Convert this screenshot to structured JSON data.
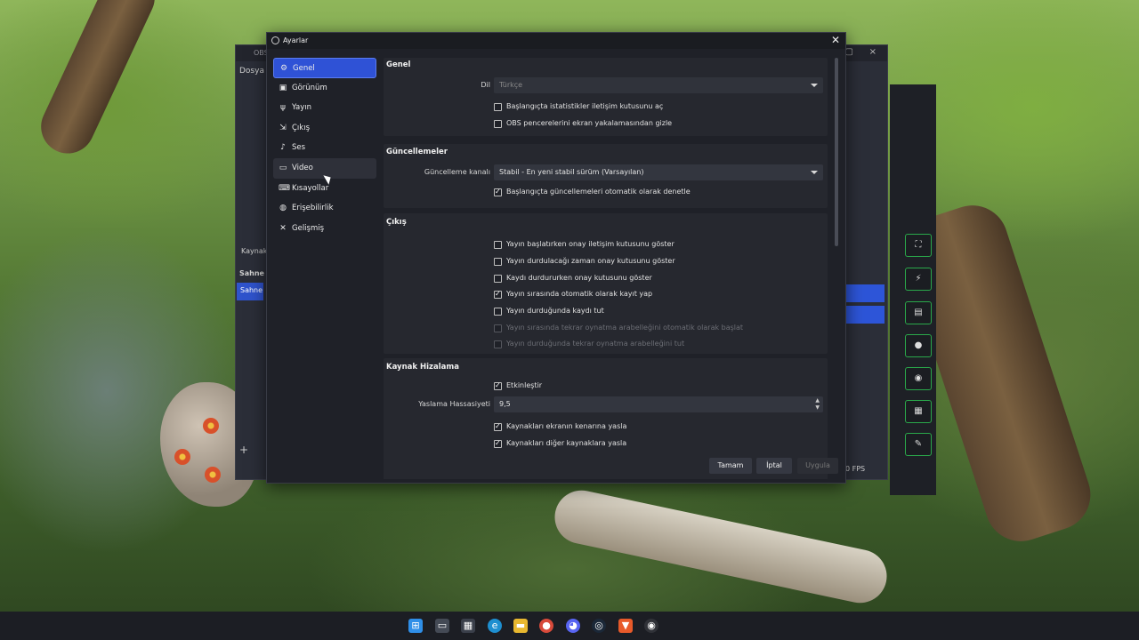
{
  "background_app": {
    "title": "OBS",
    "menu_item": "Dosya",
    "labels": {
      "kaynak": "Kaynak",
      "sahne_header": "Sahne",
      "sahne_item": "Sahne"
    },
    "fps_text": "0 FPS"
  },
  "dialog": {
    "title": "Ayarlar",
    "close_icon": "close-icon"
  },
  "sidebar": {
    "items": [
      {
        "label": "Genel",
        "icon": "gear-icon"
      },
      {
        "label": "Görünüm",
        "icon": "palette-icon"
      },
      {
        "label": "Yayın",
        "icon": "antenna-icon"
      },
      {
        "label": "Çıkış",
        "icon": "output-icon"
      },
      {
        "label": "Ses",
        "icon": "speaker-icon"
      },
      {
        "label": "Video",
        "icon": "monitor-icon"
      },
      {
        "label": "Kısayollar",
        "icon": "keyboard-icon"
      },
      {
        "label": "Erişebilirlik",
        "icon": "accessibility-icon"
      },
      {
        "label": "Gelişmiş",
        "icon": "wrench-icon"
      }
    ],
    "active_index": 0,
    "hover_index": 5
  },
  "sections": {
    "genel": {
      "title": "Genel",
      "language_label": "Dil",
      "language_value": "Türkçe",
      "checks": [
        {
          "label": "Başlangıçta istatistikler iletişim kutusunu aç",
          "checked": false
        },
        {
          "label": "OBS pencerelerini ekran yakalamasından gizle",
          "checked": false
        }
      ]
    },
    "guncellemeler": {
      "title": "Güncellemeler",
      "channel_label": "Güncelleme kanalı",
      "channel_value": "Stabil - En yeni stabil sürüm (Varsayılan)",
      "checks": [
        {
          "label": "Başlangıçta güncellemeleri otomatik olarak denetle",
          "checked": true
        }
      ]
    },
    "cikis": {
      "title": "Çıkış",
      "checks": [
        {
          "label": "Yayın başlatırken onay iletişim kutusunu göster",
          "checked": false,
          "disabled": false
        },
        {
          "label": "Yayın durdulacağı zaman onay kutusunu göster",
          "checked": false,
          "disabled": false
        },
        {
          "label": "Kaydı durdururken onay kutusunu göster",
          "checked": false,
          "disabled": false
        },
        {
          "label": "Yayın sırasında otomatik olarak kayıt yap",
          "checked": true,
          "disabled": false
        },
        {
          "label": "Yayın durduğunda kaydı tut",
          "checked": false,
          "disabled": false
        },
        {
          "label": "Yayın sırasında tekrar oynatma arabelleğini otomatik olarak başlat",
          "checked": false,
          "disabled": true
        },
        {
          "label": "Yayın durduğunda tekrar oynatma arabelleğini tut",
          "checked": false,
          "disabled": true
        }
      ]
    },
    "kaynak_hizalama": {
      "title": "Kaynak Hizalama",
      "enable_label": "Etkinleştir",
      "enable_checked": true,
      "sensitivity_label": "Yaslama Hassasiyeti",
      "sensitivity_value": "9,5",
      "checks": [
        {
          "label": "Kaynakları ekranın kenarına yasla",
          "checked": true
        },
        {
          "label": "Kaynakları diğer kaynaklara yasla",
          "checked": true
        }
      ]
    }
  },
  "buttons": {
    "ok": "Tamam",
    "cancel": "İptal",
    "apply": "Uygula"
  },
  "colors": {
    "accent": "#2f52d6",
    "dialog_bg": "#1f2128",
    "section_bg": "#26282f"
  },
  "taskbar": {
    "icons": [
      "windows-start-icon",
      "task-view-icon",
      "store-icon",
      "edge-icon",
      "file-explorer-icon",
      "chrome-icon",
      "discord-icon",
      "steam-icon",
      "brave-icon",
      "obs-icon"
    ]
  }
}
